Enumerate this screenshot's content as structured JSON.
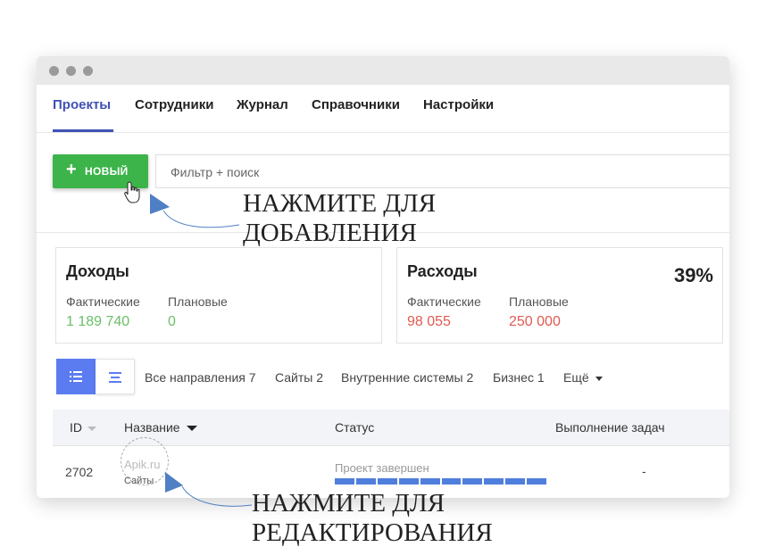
{
  "nav": {
    "tabs": [
      {
        "label": "Проекты"
      },
      {
        "label": "Сотрудники"
      },
      {
        "label": "Журнал"
      },
      {
        "label": "Справочники"
      },
      {
        "label": "Настройки"
      }
    ]
  },
  "toolbar": {
    "new_plus": "+",
    "new_label": "НОВЫЙ",
    "search_placeholder": "Фильтр + поиск"
  },
  "cards": {
    "income": {
      "title": "Доходы",
      "actual_label": "Фактические",
      "actual_value": "1 189 740",
      "plan_label": "Плановые",
      "plan_value": "0"
    },
    "expense": {
      "title": "Расходы",
      "percent": "39%",
      "actual_label": "Фактические",
      "actual_value": "98 055",
      "plan_label": "Плановые",
      "plan_value": "250 000"
    }
  },
  "filters": {
    "items": [
      "Все направления 7",
      "Сайты 2",
      "Внутренние системы 2",
      "Бизнес 1"
    ],
    "more": "Ещё"
  },
  "table": {
    "headers": {
      "id": "ID",
      "name": "Название",
      "status": "Статус",
      "tasks": "Выполнение задач"
    },
    "rows": [
      {
        "id": "2702",
        "name": "Apik.ru",
        "category": "Сайты",
        "status": "Проект завершен",
        "progress": 1.0,
        "tasks": "-"
      }
    ]
  },
  "annotations": {
    "add_line1": "НАЖМИТЕ ДЛЯ",
    "add_line2": "ДОБАВЛЕНИЯ",
    "edit_line1": "НАЖМИТЕ ДЛЯ",
    "edit_line2": "РЕДАКТИРОВАНИЯ"
  },
  "colors": {
    "accent": "#3f51b5",
    "new_button": "#3cb44a",
    "positive": "#6abf69",
    "negative": "#e05a52",
    "progress": "#4f7fdd",
    "callout_arrow": "#4f7fc4"
  },
  "icons": {
    "list_view": "list-icon",
    "compact_view": "compact-list-icon",
    "cursor": "hand-pointer-icon"
  }
}
